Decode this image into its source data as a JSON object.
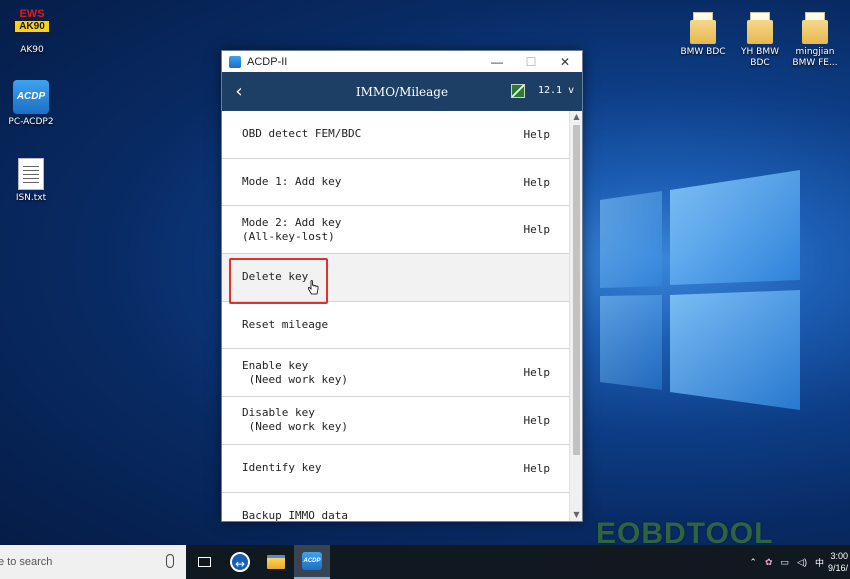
{
  "desktop": {
    "icons_left": [
      {
        "label": "AK90",
        "badge_top": "EWS",
        "badge_bottom": "AK90"
      },
      {
        "label": "PC-ACDP2",
        "badge": "ACDP"
      },
      {
        "label": "ISN.txt"
      }
    ],
    "icons_right": [
      {
        "label": "BMW BDC"
      },
      {
        "label": "YH BMW\nBDC"
      },
      {
        "label": "mingjian\nBMW FE..."
      }
    ]
  },
  "window": {
    "title": "ACDP-II",
    "controls": {
      "minimize": "—",
      "maximize": "☐",
      "close": "✕"
    },
    "appbar": {
      "back": "‹",
      "title": "IMMO/Mileage",
      "version": "12.1 v"
    },
    "menu": [
      {
        "label": "OBD detect FEM/BDC",
        "help": "Help"
      },
      {
        "label": "Mode 1: Add key",
        "help": "Help"
      },
      {
        "label": "Mode 2: Add key\n(All-key-lost)",
        "help": "Help"
      },
      {
        "label": "Delete key",
        "help": ""
      },
      {
        "label": "Reset mileage",
        "help": ""
      },
      {
        "label": "Enable key\n (Need work key)",
        "help": "Help"
      },
      {
        "label": "Disable key\n (Need work key)",
        "help": "Help"
      },
      {
        "label": "Identify key",
        "help": "Help"
      },
      {
        "label": "Backup IMMO data",
        "help": ""
      }
    ]
  },
  "watermark": "EOBDTOOL",
  "taskbar": {
    "search_placeholder": "e to search",
    "clock_time": "3:00",
    "clock_date": "9/16/"
  },
  "colors": {
    "appbar": "#1d3f66",
    "highlight": "#e03030"
  }
}
